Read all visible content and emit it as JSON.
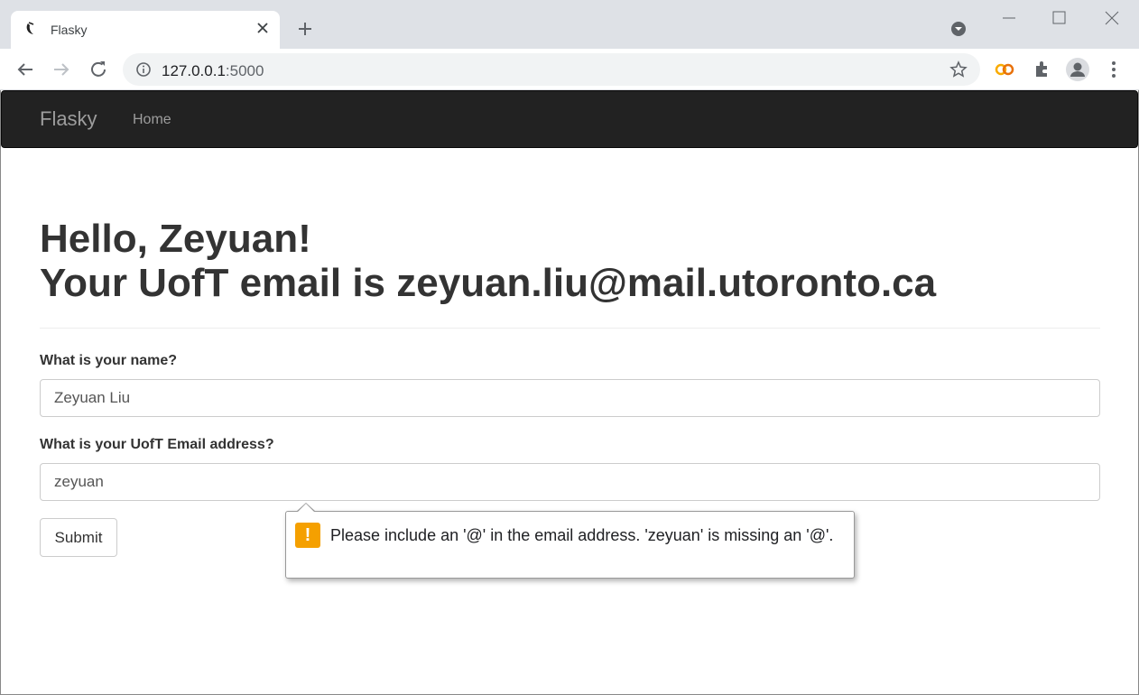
{
  "browser": {
    "tab_title": "Flasky",
    "url_host": "127.0.0.1",
    "url_port": ":5000"
  },
  "navbar": {
    "brand": "Flasky",
    "home_label": "Home"
  },
  "page": {
    "greeting": "Hello, Zeyuan!",
    "email_line": "Your UofT email is zeyuan.liu@mail.utoronto.ca"
  },
  "form": {
    "name_label": "What is your name?",
    "name_value": "Zeyuan Liu",
    "email_label": "What is your UofT Email address?",
    "email_value": "zeyuan",
    "submit_label": "Submit"
  },
  "validation": {
    "message": "Please include an '@' in the email address. 'zeyuan' is missing an '@'.",
    "icon": "!"
  },
  "colors": {
    "navbar_bg": "#222222",
    "warning": "#f5a000"
  }
}
